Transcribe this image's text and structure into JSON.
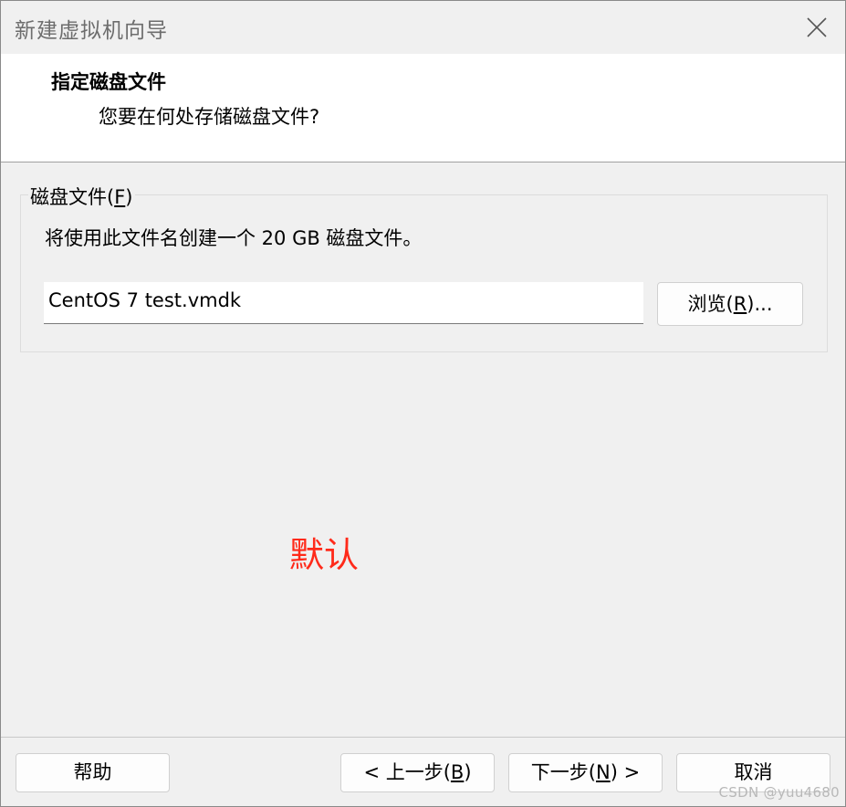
{
  "window": {
    "title": "新建虚拟机向导"
  },
  "header": {
    "title": "指定磁盘文件",
    "subtitle": "您要在何处存储磁盘文件?"
  },
  "group": {
    "legend_prefix": "磁盘文件(",
    "legend_key": "F",
    "legend_suffix": ")",
    "description": "将使用此文件名创建一个 20 GB 磁盘文件。",
    "file_value": "CentOS 7 test.vmdk",
    "browse_prefix": "浏览(",
    "browse_key": "R",
    "browse_suffix": ")..."
  },
  "annotation": {
    "text": "默认",
    "color": "#ff2a1a"
  },
  "footer": {
    "help_label": "帮助",
    "back_prefix": "< 上一步(",
    "back_key": "B",
    "back_suffix": ")",
    "next_prefix": "下一步(",
    "next_key": "N",
    "next_suffix": ") >",
    "cancel_label": "取消"
  },
  "watermark": {
    "text": "CSDN @yuu4680"
  },
  "icons": {
    "close": "close-icon"
  }
}
